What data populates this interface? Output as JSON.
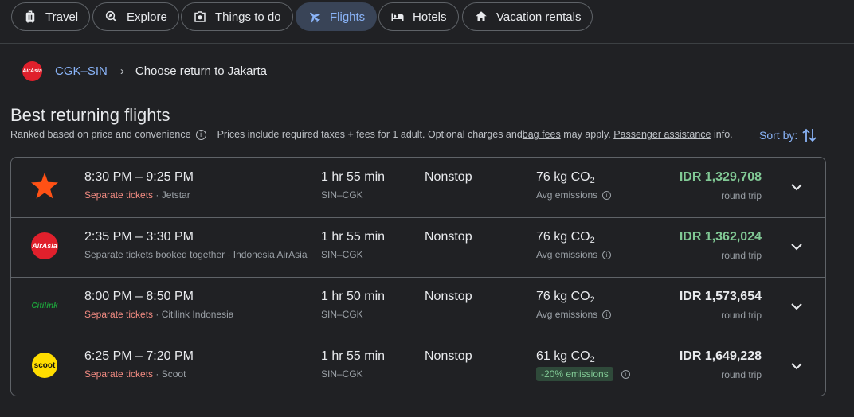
{
  "nav": {
    "tabs": [
      {
        "label": "Travel",
        "icon": "travel-bag-icon"
      },
      {
        "label": "Explore",
        "icon": "explore-icon"
      },
      {
        "label": "Things to do",
        "icon": "camera-icon"
      },
      {
        "label": "Flights",
        "icon": "airplane-icon",
        "active": true
      },
      {
        "label": "Hotels",
        "icon": "bed-icon"
      },
      {
        "label": "Vacation rentals",
        "icon": "house-icon"
      }
    ]
  },
  "breadcrumb": {
    "airline_logo": "AirAsia",
    "route": "CGK–SIN",
    "current": "Choose return to Jakarta"
  },
  "header": {
    "title": "Best returning flights",
    "ranked": "Ranked based on price and convenience",
    "prices_note_1": "Prices include required taxes + fees for 1 adult. Optional charges and ",
    "bag_fees": "bag fees",
    "prices_note_2": " may apply. ",
    "passenger_assistance": "Passenger assistance",
    "prices_note_3": " info.",
    "sort_label": "Sort by:"
  },
  "colors": {
    "accent": "#8ab4f8",
    "price_green": "#81c995",
    "separate_tickets": "#f28b82",
    "airasia_red": "#e0202c",
    "jetstar_orange": "#ff5115",
    "scoot_yellow": "#ffdd00",
    "citilink_green": "#1d9b3a"
  },
  "flights": [
    {
      "airline_icon": "jetstar-logo",
      "times": "8:30 PM – 9:25 PM",
      "separate": "Separate tickets",
      "airline_text": " · Jetstar",
      "duration": "1 hr 55 min",
      "route": "SIN–CGK",
      "stops": "Nonstop",
      "co2_value": "76 kg CO",
      "co2_sub": "2",
      "emissions": "Avg emissions",
      "price": "IDR 1,329,708",
      "price_green": true,
      "trip_type": "round trip"
    },
    {
      "airline_icon": "airasia-logo",
      "times": "2:35 PM – 3:30 PM",
      "separate": "Separate tickets booked together",
      "airline_text": " · Indonesia AirAsia",
      "separate_plain": true,
      "duration": "1 hr 55 min",
      "route": "SIN–CGK",
      "stops": "Nonstop",
      "co2_value": "76 kg CO",
      "co2_sub": "2",
      "emissions": "Avg emissions",
      "price": "IDR 1,362,024",
      "price_green": true,
      "trip_type": "round trip"
    },
    {
      "airline_icon": "citilink-logo",
      "times": "8:00 PM – 8:50 PM",
      "separate": "Separate tickets",
      "airline_text": " · Citilink Indonesia",
      "duration": "1 hr 50 min",
      "route": "SIN–CGK",
      "stops": "Nonstop",
      "co2_value": "76 kg CO",
      "co2_sub": "2",
      "emissions": "Avg emissions",
      "price": "IDR 1,573,654",
      "price_green": false,
      "trip_type": "round trip"
    },
    {
      "airline_icon": "scoot-logo",
      "times": "6:25 PM – 7:20 PM",
      "separate": "Separate tickets",
      "airline_text": " · Scoot",
      "duration": "1 hr 55 min",
      "route": "SIN–CGK",
      "stops": "Nonstop",
      "co2_value": "61 kg CO",
      "co2_sub": "2",
      "emissions": "-20% emissions",
      "emissions_badge": true,
      "price": "IDR 1,649,228",
      "price_green": false,
      "trip_type": "round trip"
    }
  ],
  "logos": {
    "airasia_text": "AirAsia",
    "citilink_text": "Citilink",
    "scoot_text": "scoot"
  }
}
